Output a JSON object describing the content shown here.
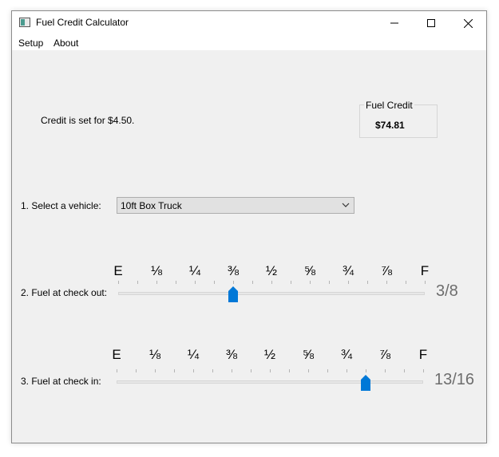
{
  "window": {
    "title": "Fuel Credit Calculator"
  },
  "menu": [
    "Setup",
    "About"
  ],
  "credit": {
    "rate_text": "Credit is set for $4.50.",
    "group_label": "Fuel Credit",
    "value": "$74.81"
  },
  "vehicle": {
    "label": "1. Select a vehicle:",
    "selected": "10ft Box Truck"
  },
  "gauge_marks": [
    "E",
    "⅛",
    "¼",
    "⅜",
    "½",
    "⅝",
    "¾",
    "⅞",
    "F"
  ],
  "fuel_out": {
    "label": "2. Fuel at check out:",
    "readout": "3/8",
    "level": 0.375
  },
  "fuel_in": {
    "label": "3. Fuel at check in:",
    "readout": "13/16",
    "level": 0.8125
  },
  "colors": {
    "accent": "#0078d7",
    "readout": "#6d6d6d",
    "window_bg": "#f0f0f0"
  }
}
